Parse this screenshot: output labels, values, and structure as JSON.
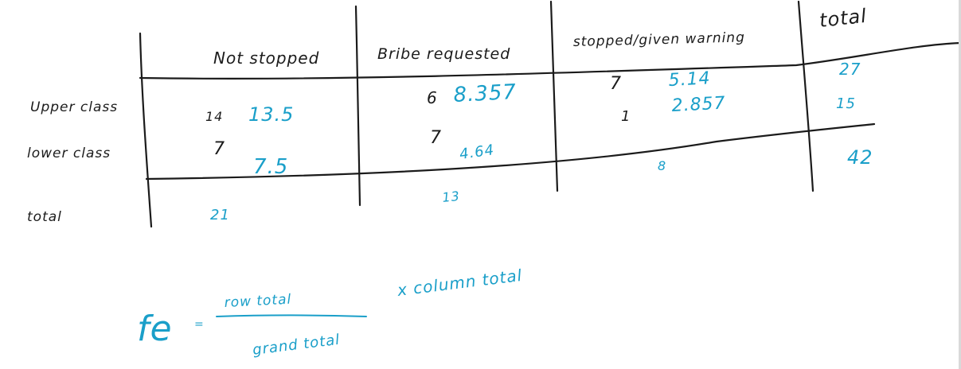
{
  "table": {
    "headers": {
      "col1": "Not stopped",
      "col2": "Bribe requested",
      "col3": "stopped/given warning",
      "col4": "total"
    },
    "rows": [
      {
        "label": "Upper class",
        "not_stopped_observed": "14",
        "not_stopped_expected": "13.5",
        "bribe_observed": "6",
        "bribe_expected": "8.357",
        "warning_observed": "7",
        "warning_expected": "5.14",
        "total": "27"
      },
      {
        "label": "lower class",
        "not_stopped_observed": "7",
        "not_stopped_expected": "7.5",
        "bribe_observed": "7",
        "bribe_expected": "4.64",
        "warning_observed": "1",
        "warning_expected": "2.857",
        "total": "15"
      }
    ],
    "totals": {
      "label": "total",
      "not_stopped": "21",
      "bribe": "13",
      "warning": "8",
      "grand_total": "42"
    }
  },
  "formula": {
    "symbol": "fe",
    "equals": "=",
    "numerator": "row total",
    "denominator": "grand total",
    "multiplier": "x column total"
  }
}
